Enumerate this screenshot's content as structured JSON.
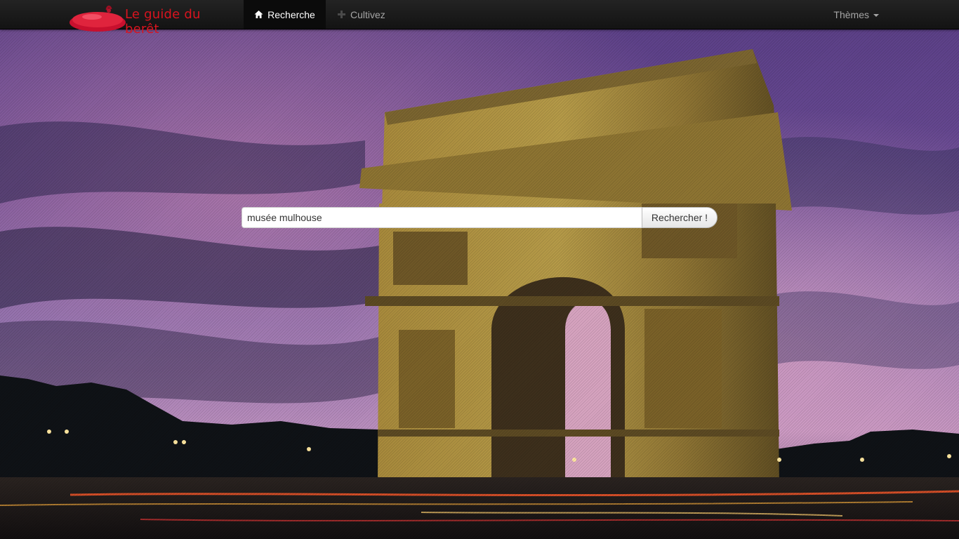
{
  "brand": {
    "name": "Le guide du berêt",
    "logo_icon": "beret-icon"
  },
  "nav": {
    "items": [
      {
        "label": "Recherche",
        "icon": "home-icon",
        "active": true
      },
      {
        "label": "Cultivez",
        "icon": "plus-icon",
        "active": false
      }
    ],
    "themes_label": "Thèmes"
  },
  "search": {
    "value": "musée mulhouse",
    "button_label": "Rechercher !"
  },
  "colors": {
    "navbar_bg": "#1b1b1b",
    "brand_red": "#d8141f",
    "nav_active_text": "#ffffff",
    "nav_inactive_text": "#a5a5a5"
  }
}
